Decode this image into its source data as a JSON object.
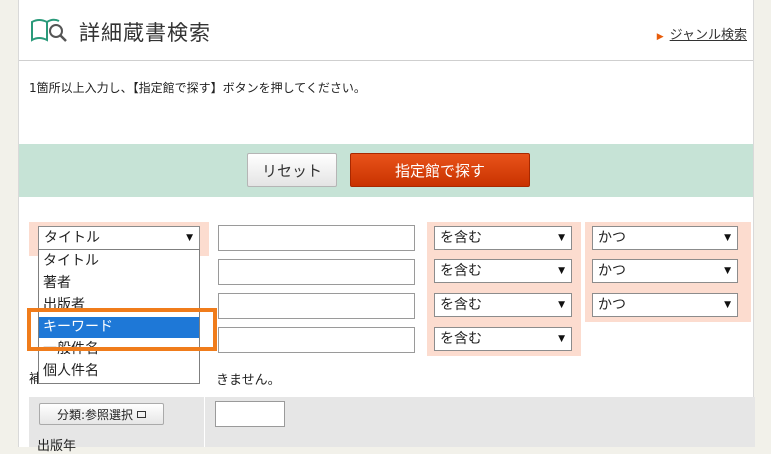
{
  "header": {
    "title": "詳細蔵書検索",
    "genre_link": "ジャンル検索"
  },
  "instruction": "1箇所以上入力し、【指定館で探す】ボタンを押してください。",
  "buttons": {
    "reset": "リセット",
    "search": "指定館で探す"
  },
  "rows": [
    {
      "field": "タイトル",
      "match": "を含む",
      "conj": "かつ"
    },
    {
      "field": "",
      "match": "を含む",
      "conj": "かつ"
    },
    {
      "field": "",
      "match": "を含む",
      "conj": "かつ"
    },
    {
      "field": "",
      "match": "を含む",
      "conj": ""
    }
  ],
  "dropdown_options": [
    "タイトル",
    "著者",
    "出版者",
    "キーワード",
    "一般件名",
    "個人件名"
  ],
  "dropdown_selected": "キーワード",
  "note": {
    "start": "補",
    "end": "きません。"
  },
  "category_button": "分類:参照選択",
  "pub_year_label": "出版年",
  "colors": {
    "accent": "#e8531a",
    "action_bar": "#c6e3d6",
    "row_bg": "#fcdccf",
    "highlight": "#f07c1b",
    "selection": "#1e78d7"
  },
  "icons": {
    "header": "book-search-icon",
    "genre": "triangle-right-icon",
    "dropdown": "caret-down-icon",
    "category": "window-icon"
  }
}
